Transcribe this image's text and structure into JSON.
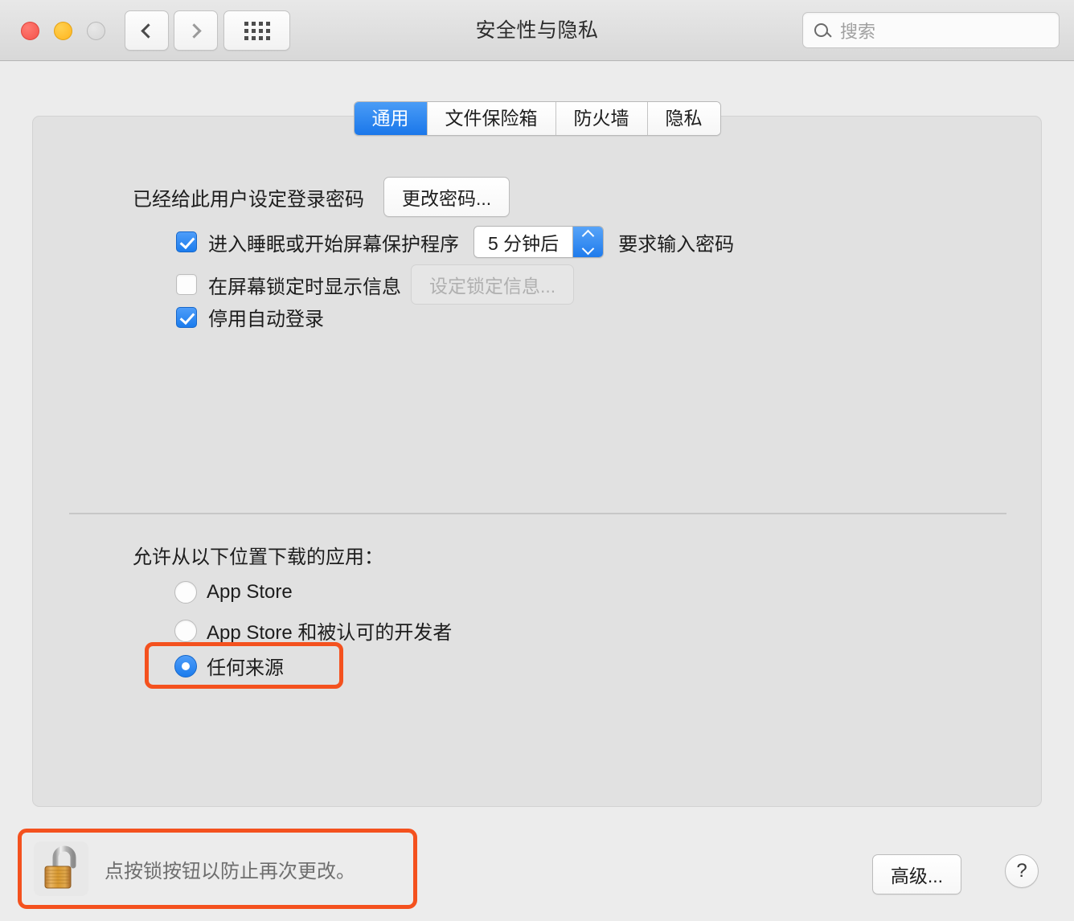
{
  "window": {
    "title": "安全性与隐私",
    "traffic_lights": [
      "close",
      "minimize",
      "zoom"
    ],
    "nav": {
      "back": "‹",
      "forward": "›",
      "grid": "show-all"
    }
  },
  "search": {
    "placeholder": "搜索",
    "value": ""
  },
  "tabs": [
    {
      "label": "通用",
      "active": true
    },
    {
      "label": "文件保险箱",
      "active": false
    },
    {
      "label": "防火墙",
      "active": false
    },
    {
      "label": "隐私",
      "active": false
    }
  ],
  "general": {
    "password_status": "已经给此用户设定登录密码",
    "change_password_button": "更改密码...",
    "checkboxes": [
      {
        "label": "进入睡眠或开始屏幕保护程序",
        "checked": true,
        "stepper_value": "5 分钟后",
        "suffix": "要求输入密码"
      },
      {
        "label": "在屏幕锁定时显示信息",
        "checked": false,
        "button": "设定锁定信息...",
        "button_disabled": true
      },
      {
        "label": "停用自动登录",
        "checked": true
      }
    ],
    "download_section": {
      "title": "允许从以下位置下载的应用：",
      "options": [
        {
          "label": "App Store",
          "selected": false
        },
        {
          "label": "App Store 和被认可的开发者",
          "selected": false
        },
        {
          "label": "任何来源",
          "selected": true
        }
      ]
    }
  },
  "footer": {
    "lock_message": "点按锁按钮以防止再次更改。",
    "lock_state": "unlocked",
    "advanced_button": "高级...",
    "help_button": "?"
  },
  "colors": {
    "accent_blue": "#1b7ced",
    "highlight_orange": "#f4511e",
    "window_bg": "#ececec",
    "panel_bg": "#e1e1e1",
    "lock_gold": "#d19a3e"
  }
}
